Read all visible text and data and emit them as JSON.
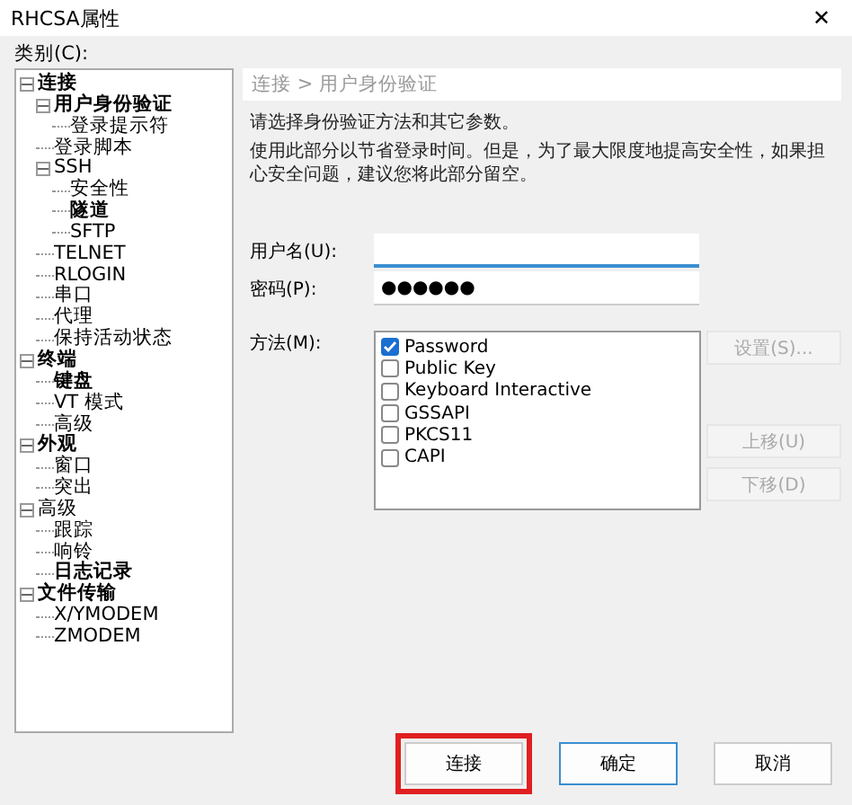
{
  "window": {
    "title": "RHCSA属性",
    "close": "✕"
  },
  "category_label": "类别(C):",
  "tree": [
    {
      "label": "连接",
      "modified": true,
      "expanded": true,
      "children": [
        {
          "label": "用户身份验证",
          "modified": true,
          "expanded": true,
          "children": [
            {
              "label": "登录提示符",
              "modified": false
            }
          ]
        },
        {
          "label": "登录脚本",
          "modified": false
        },
        {
          "label": "SSH",
          "modified": false,
          "expanded": true,
          "children": [
            {
              "label": "安全性",
              "modified": false
            },
            {
              "label": "隧道",
              "modified": true
            },
            {
              "label": "SFTP",
              "modified": false
            }
          ]
        },
        {
          "label": "TELNET",
          "modified": false
        },
        {
          "label": "RLOGIN",
          "modified": false
        },
        {
          "label": "串口",
          "modified": false
        },
        {
          "label": "代理",
          "modified": false
        },
        {
          "label": "保持活动状态",
          "modified": false
        }
      ]
    },
    {
      "label": "终端",
      "modified": true,
      "expanded": true,
      "children": [
        {
          "label": "键盘",
          "modified": true
        },
        {
          "label": "VT 模式",
          "modified": false
        },
        {
          "label": "高级",
          "modified": false
        }
      ]
    },
    {
      "label": "外观",
      "modified": true,
      "expanded": true,
      "children": [
        {
          "label": "窗口",
          "modified": false
        },
        {
          "label": "突出",
          "modified": false
        }
      ]
    },
    {
      "label": "高级",
      "modified": false,
      "expanded": true,
      "children": [
        {
          "label": "跟踪",
          "modified": false
        },
        {
          "label": "响铃",
          "modified": false
        },
        {
          "label": "日志记录",
          "modified": true
        }
      ]
    },
    {
      "label": "文件传输",
      "modified": true,
      "expanded": true,
      "children": [
        {
          "label": "X/YMODEM",
          "modified": false
        },
        {
          "label": "ZMODEM",
          "modified": false
        }
      ]
    }
  ],
  "breadcrumb": "连接 > 用户身份验证",
  "intro": "请选择身份验证方法和其它参数。",
  "note": "使用此部分以节省登录时间。但是，为了最大限度地提高安全性，如果担心安全问题，建议您将此部分留空。",
  "username": {
    "label": "用户名(U):",
    "focused": true
  },
  "password": {
    "label": "密码(P):",
    "value": "●●●●●●",
    "focused": false
  },
  "methods": {
    "label": "方法(M):",
    "items": [
      {
        "label": "Password",
        "checked": true
      },
      {
        "label": "Public Key",
        "checked": false
      },
      {
        "label": "Keyboard Interactive",
        "checked": false
      },
      {
        "label": "GSSAPI",
        "checked": false
      },
      {
        "label": "PKCS11",
        "checked": false
      },
      {
        "label": "CAPI",
        "checked": false
      }
    ]
  },
  "side_buttons": [
    {
      "label": "设置(S)...",
      "disabled": true
    },
    {
      "label": "上移(U)",
      "disabled": true
    },
    {
      "label": "下移(D)",
      "disabled": true
    }
  ],
  "footer_buttons": [
    {
      "label": "连接",
      "highlighted": true,
      "default": false
    },
    {
      "label": "确定",
      "highlighted": false,
      "default": true
    },
    {
      "label": "取消",
      "highlighted": false,
      "default": false
    }
  ]
}
